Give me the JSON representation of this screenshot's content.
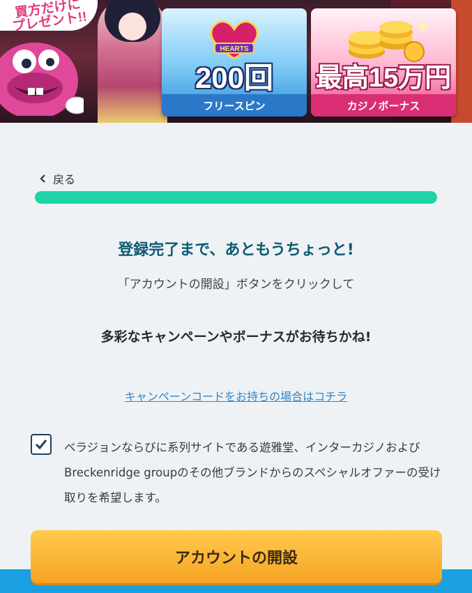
{
  "banner": {
    "promo_text": "買方だけに\nプレゼント!!",
    "card_spins": {
      "logo_text": "HEARTS",
      "big": "200回",
      "sub": "フリースピン"
    },
    "card_bonus": {
      "big": "最高15万円",
      "sub": "カジノボーナス"
    }
  },
  "nav": {
    "back_label": "戻る"
  },
  "progress": {
    "percent": 100,
    "color": "#1fd3a7"
  },
  "content": {
    "headline": "登録完了まで、あともうちょっと!",
    "line2": "「アカウントの開設」ボタンをクリックして",
    "line3": "多彩なキャンペーンやボーナスがお待ちかね!",
    "promo_link": "キャンペーンコードをお持ちの場合はコチラ"
  },
  "consent": {
    "checked": true,
    "text": "ベラジョンならびに系列サイトである遊雅堂、インターカジノおよびBreckenridge groupのその他ブランドからのスペシャルオファーの受け取りを希望します。"
  },
  "cta": {
    "label": "アカウントの開設"
  },
  "colors": {
    "accent": "#1fd3a7",
    "headline": "#0e5a73",
    "cta": "#f6a323",
    "link": "#2f86c9"
  }
}
